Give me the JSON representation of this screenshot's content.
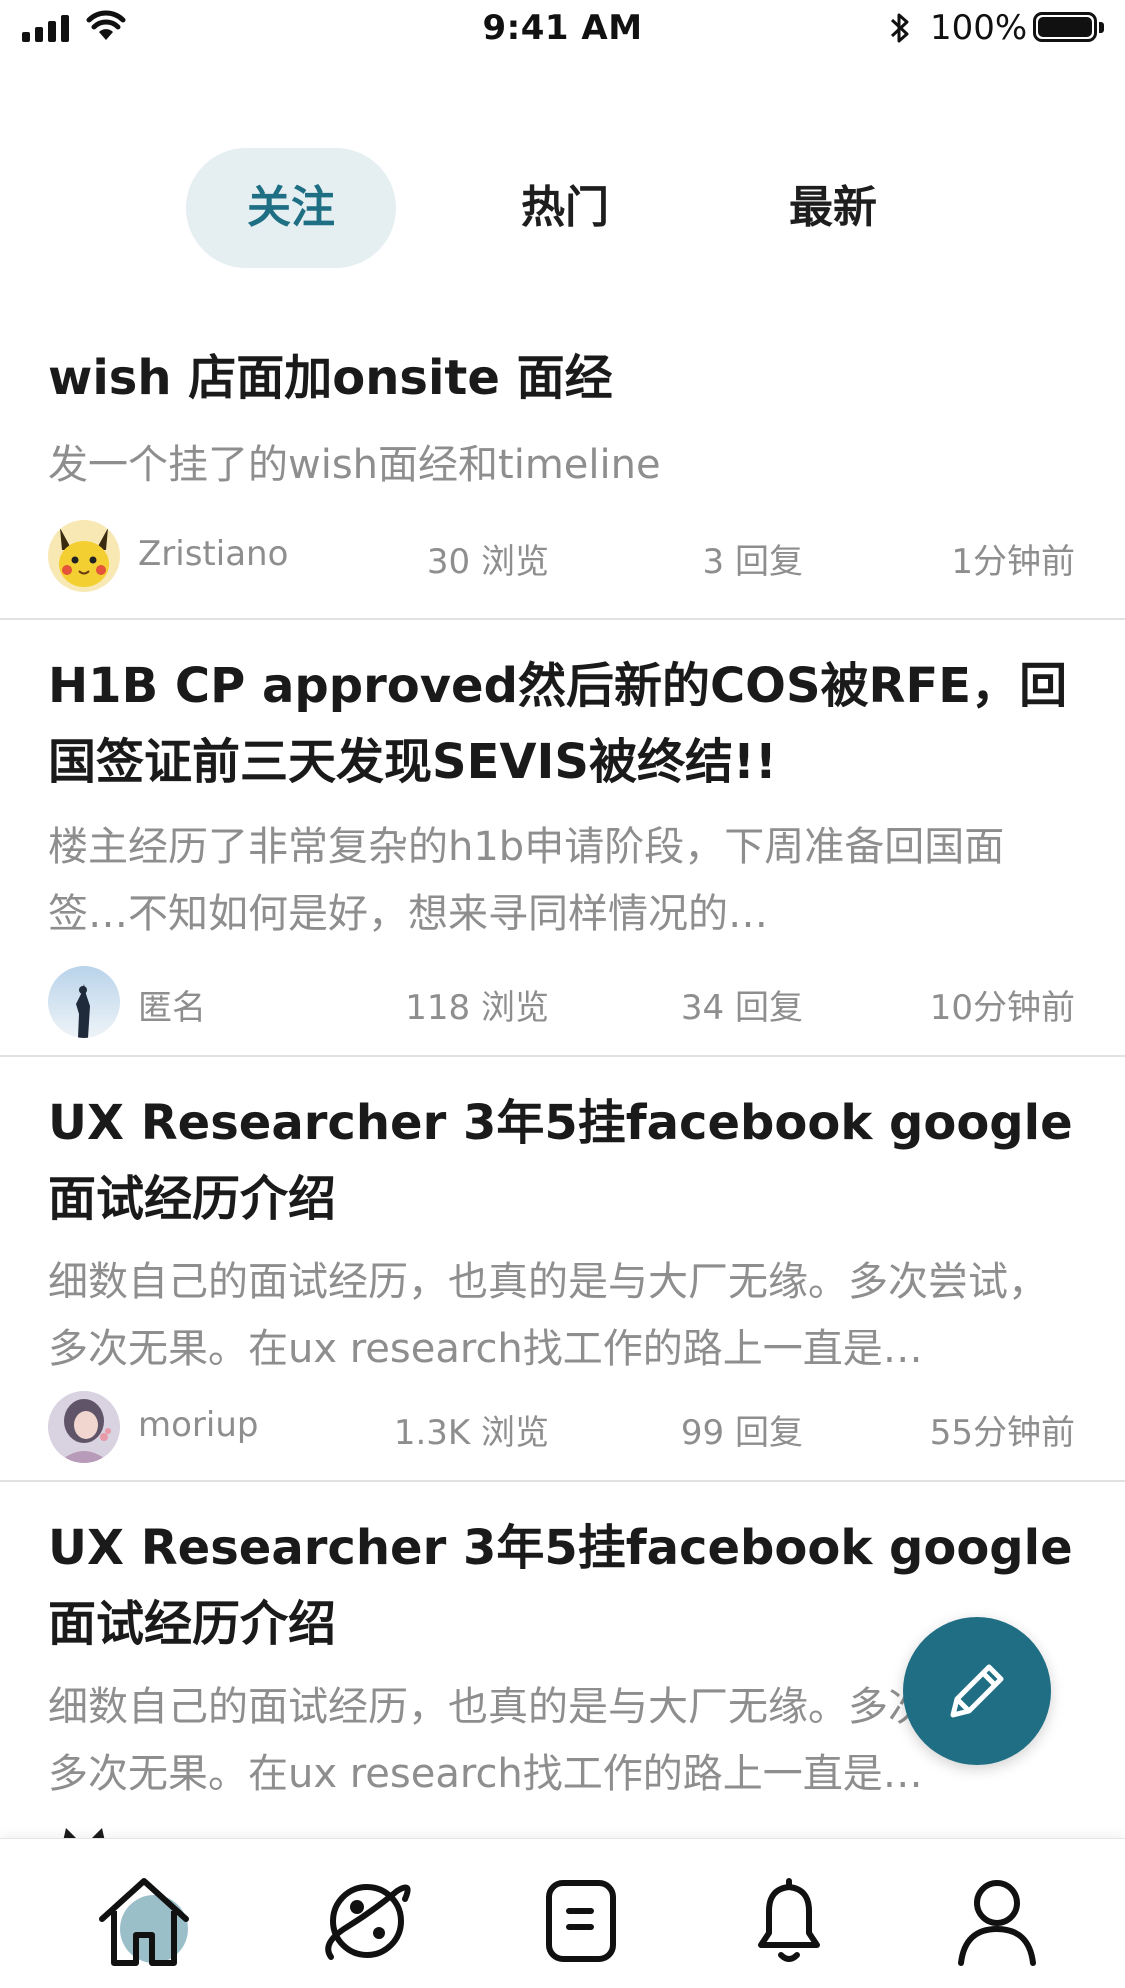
{
  "status_bar": {
    "time": "9:41 AM",
    "battery_percent": "100%",
    "icons": [
      "signal-icon",
      "wifi-icon",
      "bluetooth-icon",
      "battery-icon"
    ]
  },
  "tabs": [
    {
      "label": "关注",
      "active": true
    },
    {
      "label": "热门",
      "active": false
    },
    {
      "label": "最新",
      "active": false
    }
  ],
  "posts": [
    {
      "title": "wish 店面加onsite 面经",
      "summary": "发一个挂了的wish面经和timeline",
      "author": "Zristiano",
      "views": "30 浏览",
      "replies": "3 回复",
      "time": "1分钟前",
      "avatar_icon": "pikachu-avatar"
    },
    {
      "title": "H1B CP approved然后新的COS被RFE，回国签证前三天发现SEVIS被终结!!",
      "summary": "楼主经历了非常复杂的h1b申请阶段，下周准备回国面签…不知如何是好，想来寻同样情况的…",
      "author": "匿名",
      "views": "118 浏览",
      "replies": "34 回复",
      "time": "10分钟前",
      "avatar_icon": "anonymous-avatar"
    },
    {
      "title": "UX Researcher 3年5挂facebook google面试经历介绍",
      "summary": "细数自己的面试经历，也真的是与大厂无缘。多次尝试，多次无果。在ux research找工作的路上一直是…",
      "author": "moriup",
      "views": "1.3K 浏览",
      "replies": "99 回复",
      "time": "55分钟前",
      "avatar_icon": "user-avatar"
    },
    {
      "title": "UX Researcher 3年5挂facebook google面试经历介绍",
      "summary": "细数自己的面试经历，也真的是与大厂无缘。多次尝试，多次无果。在ux research找工作的路上一直是…",
      "author": "",
      "views": "",
      "replies": "",
      "time": "",
      "avatar_icon": "cat-avatar"
    }
  ],
  "fab": {
    "icon": "pencil-icon"
  },
  "tabbar": [
    {
      "icon": "home-icon",
      "active": true
    },
    {
      "icon": "planet-icon",
      "active": false
    },
    {
      "icon": "notes-icon",
      "active": false
    },
    {
      "icon": "bell-icon",
      "active": false
    },
    {
      "icon": "profile-icon",
      "active": false
    }
  ],
  "colors": {
    "accent": "#1f6e84",
    "tab_active_bg": "#e5eff2",
    "muted_text": "#8e8e8e",
    "home_highlight": "#9bbfc9"
  }
}
